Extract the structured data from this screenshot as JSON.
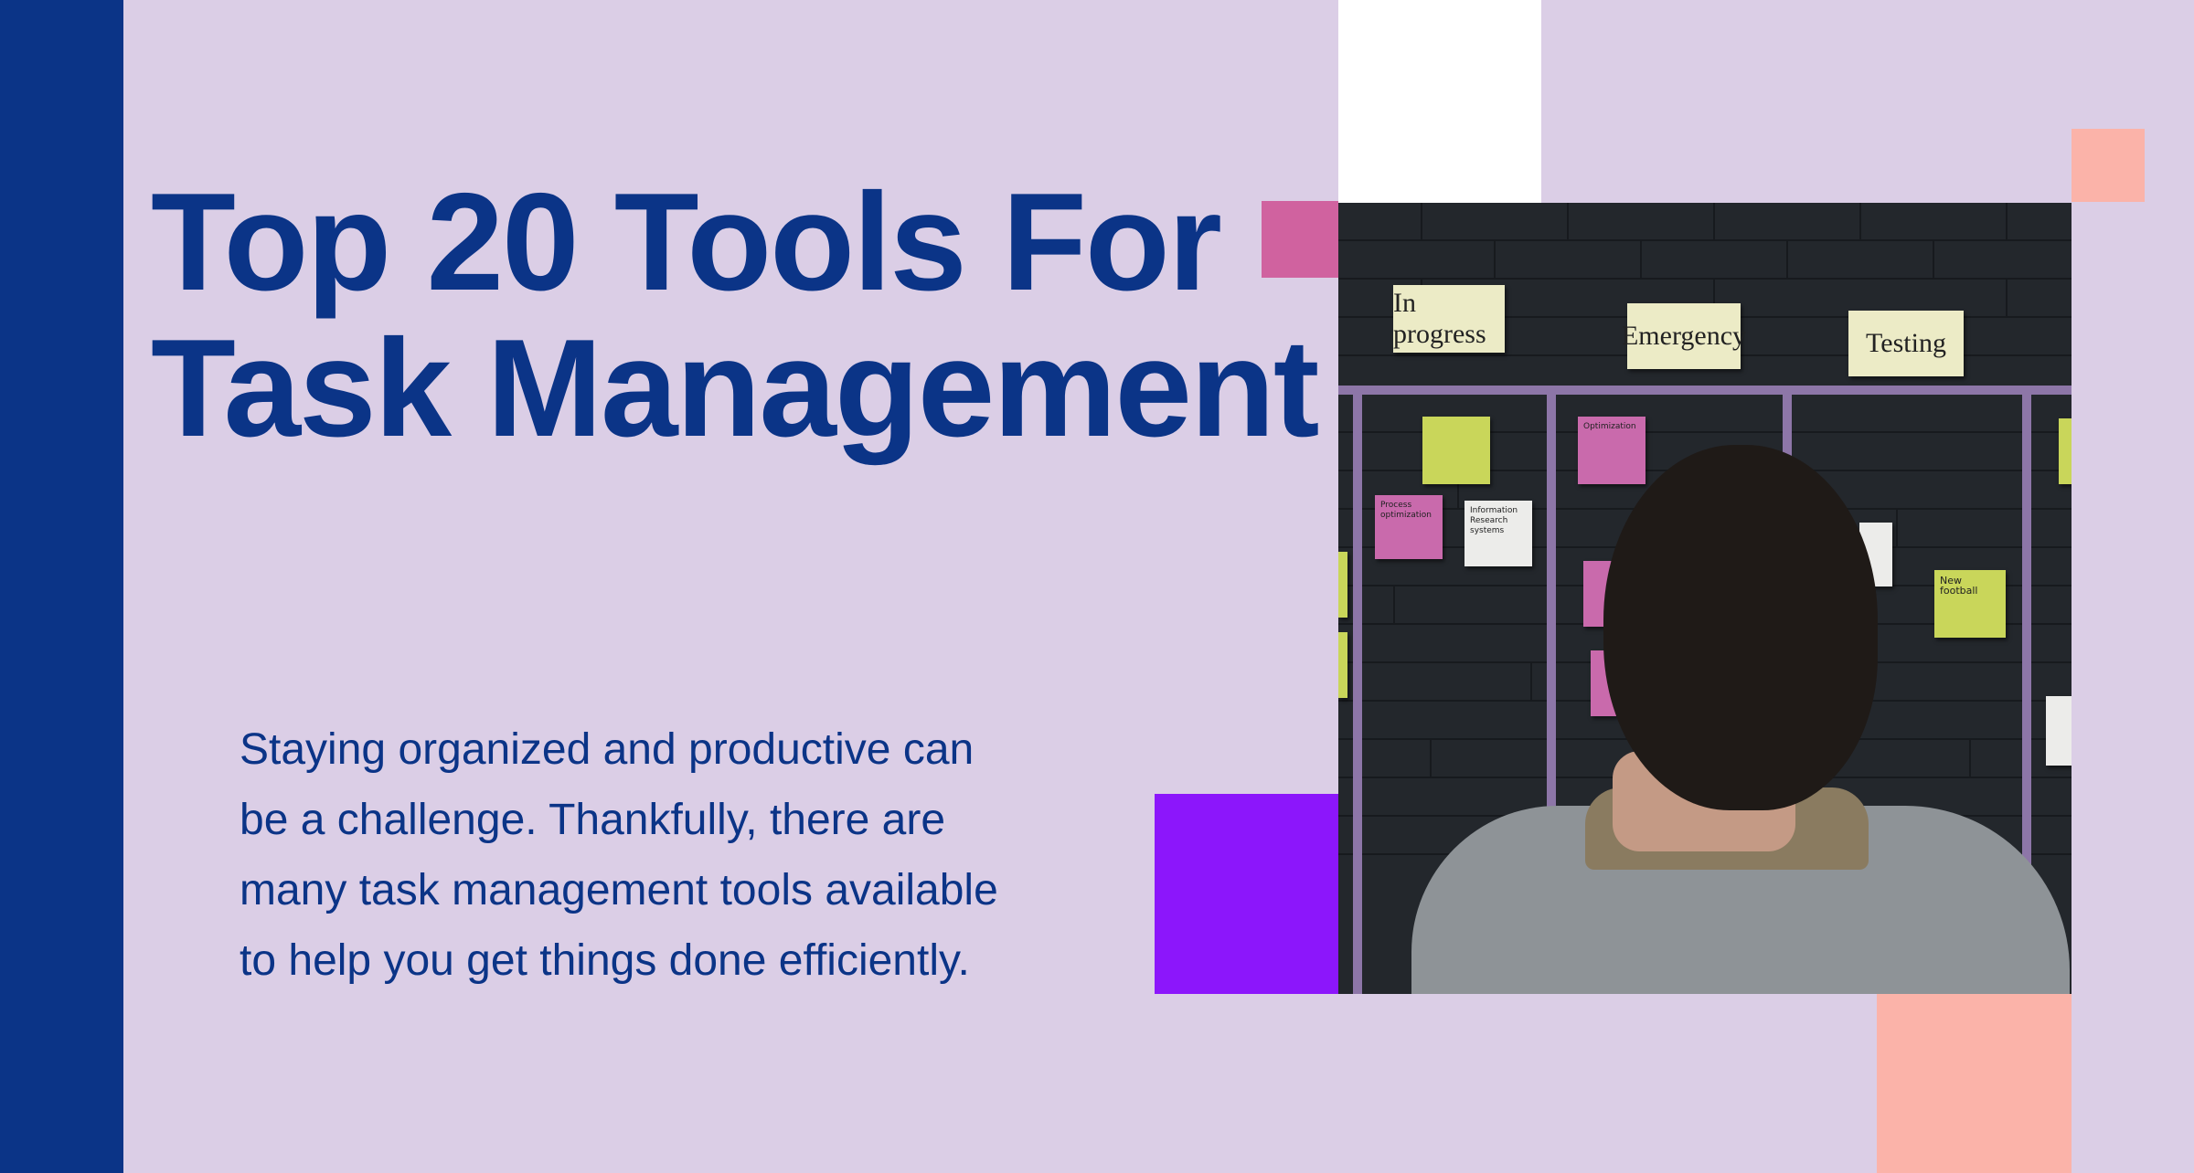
{
  "title": {
    "line1": "Top 20 Tools For",
    "line2": "Task Management"
  },
  "intro": {
    "line1": "Staying organized and productive can",
    "line2": "be a challenge. Thankfully, there are",
    "line3": "many task management tools available",
    "line4": "to help you get things done efficiently."
  },
  "photo": {
    "column_headers": [
      "In progress",
      "Emergency",
      "Testing"
    ],
    "notes": {
      "process": "Process optimization",
      "info": "Information Research systems",
      "optimization": "Optimization",
      "football": "New football"
    }
  },
  "colors": {
    "background": "#dbcee6",
    "primary": "#0b3487",
    "pink": "#d0629f",
    "purple": "#8c16fb",
    "peach": "#fbb3a9",
    "white": "#ffffff"
  }
}
